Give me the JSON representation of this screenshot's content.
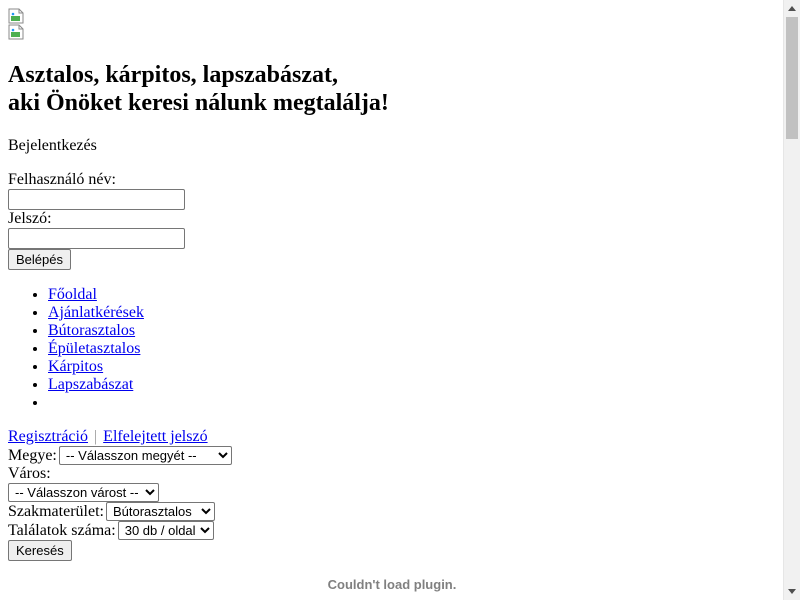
{
  "images": {
    "logo_alt": "",
    "banner_alt": ""
  },
  "headline": {
    "line1": "Asztalos, kárpitos, lapszabászat,",
    "line2": "aki Önöket keresi nálunk megtalálja!"
  },
  "login": {
    "title": "Bejelentkezés",
    "username_label": "Felhasználó név:",
    "username_value": "",
    "password_label": "Jelszó:",
    "password_value": "",
    "submit_label": "Belépés"
  },
  "nav": {
    "items": [
      {
        "label": "Főoldal"
      },
      {
        "label": "Ajánlatkérések"
      },
      {
        "label": "Bútorasztalos"
      },
      {
        "label": "Épületasztalos"
      },
      {
        "label": "Kárpitos"
      },
      {
        "label": "Lapszabászat"
      },
      {
        "label": ""
      }
    ]
  },
  "account_links": {
    "register": "Regisztráció",
    "separator": "|",
    "forgot_password": "Elfelejtett jelszó"
  },
  "search": {
    "county_label": "Megye:",
    "county_selected": "-- Válasszon megyét --",
    "city_label": "Város:",
    "city_selected": "-- Válasszon várost --",
    "field_label": "Szakmaterület:",
    "field_selected": "Bútorasztalos",
    "results_label": "Találatok száma:",
    "results_selected": "30 db / oldal",
    "submit_label": "Keresés"
  },
  "plugin": {
    "message": "Couldn't load plugin."
  },
  "colors": {
    "link": "#0000ee",
    "plugin_text": "#808080",
    "scrollbar_track": "#f1f1f1",
    "scrollbar_thumb": "#c1c1c1"
  }
}
